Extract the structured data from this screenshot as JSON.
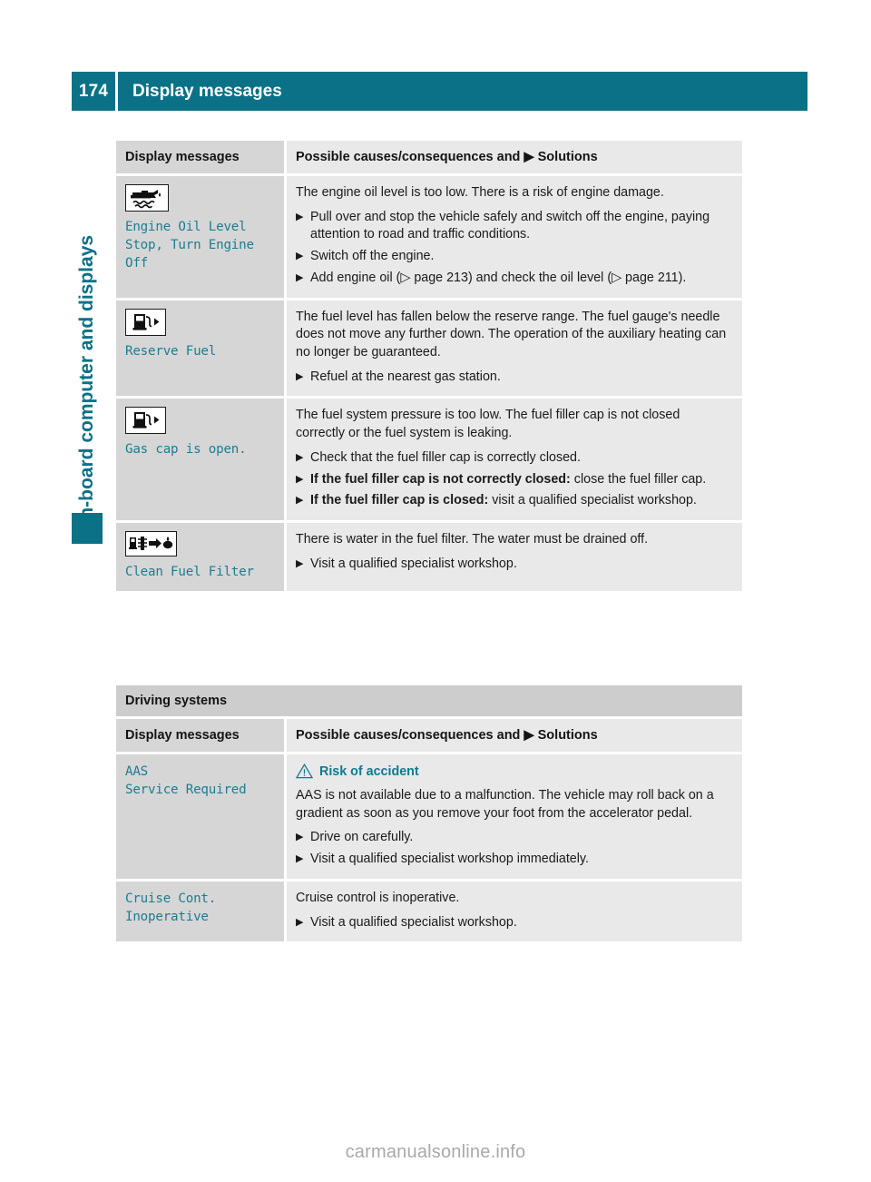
{
  "page": {
    "number": "174",
    "title": "Display messages",
    "side_tab_label": "On-board computer and displays",
    "watermark": "carmanualsonline.info",
    "accent_color": "#0a7186",
    "message_text_color": "#1b7d91"
  },
  "table_headers": {
    "col1": "Display messages",
    "col2_prefix": "Possible causes/consequences and",
    "col2_suffix": "Solutions"
  },
  "table1": {
    "rows": [
      {
        "icon": "engine-oil-can-icon",
        "message": "Engine Oil Level\nStop, Turn Engine\nOff",
        "intro": "The engine oil level is too low. There is a risk of engine damage.",
        "bullets": [
          {
            "text": "Pull over and stop the vehicle safely and switch off the engine, paying attention to road and traffic conditions."
          },
          {
            "text": "Switch off the engine."
          },
          {
            "text": "Add engine oil (▷ page 213) and check the oil level (▷ page 211)."
          }
        ]
      },
      {
        "icon": "fuel-pump-icon",
        "message": "Reserve Fuel",
        "intro": "The fuel level has fallen below the reserve range. The fuel gauge's needle does not move any further down. The operation of the auxiliary heating can no longer be guaranteed.",
        "bullets": [
          {
            "text": "Refuel at the nearest gas station."
          }
        ]
      },
      {
        "icon": "fuel-pump-icon",
        "message": "Gas cap is open.",
        "intro": "The fuel system pressure is too low. The fuel filler cap is not closed correctly or the fuel system is leaking.",
        "bullets": [
          {
            "text": "Check that the fuel filler cap is correctly closed."
          },
          {
            "bold": "If the fuel filler cap is not correctly closed:",
            "text": "close the fuel filler cap."
          },
          {
            "bold": "If the fuel filler cap is closed:",
            "text": "visit a qualified specialist workshop."
          }
        ]
      },
      {
        "icon": "fuel-filter-water-icon",
        "message": "Clean Fuel Filter",
        "intro": "There is water in the fuel filter. The water must be drained off.",
        "bullets": [
          {
            "text": "Visit a qualified specialist workshop."
          }
        ]
      }
    ]
  },
  "table2": {
    "section_title": "Driving systems",
    "rows": [
      {
        "message": "AAS\nService Required",
        "warning": "Risk of accident",
        "intro": "AAS is not available due to a malfunction. The vehicle may roll back on a gradient as soon as you remove your foot from the accelerator pedal.",
        "bullets": [
          {
            "text": "Drive on carefully."
          },
          {
            "text": "Visit a qualified specialist workshop immediately."
          }
        ]
      },
      {
        "message": "Cruise Cont.\nInoperative",
        "intro": "Cruise control is inoperative.",
        "bullets": [
          {
            "text": "Visit a qualified specialist workshop."
          }
        ]
      }
    ]
  }
}
